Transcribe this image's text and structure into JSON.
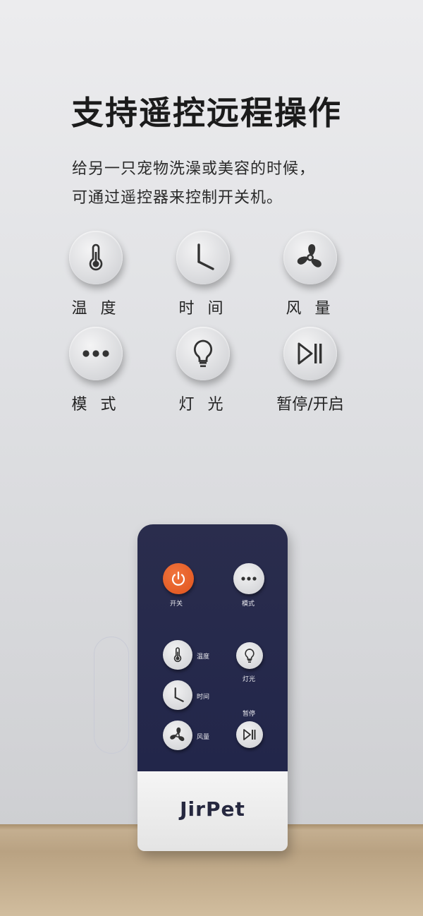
{
  "headline": "支持遥控远程操作",
  "subtitle_line1": "给另一只宠物洗澡或美容的时候，",
  "subtitle_line2": "可通过遥控器来控制开关机。",
  "features": [
    {
      "label": "温 度",
      "icon": "thermometer-icon"
    },
    {
      "label": "时 间",
      "icon": "clock-icon"
    },
    {
      "label": "风 量",
      "icon": "fan-icon"
    },
    {
      "label": "模 式",
      "icon": "dots-icon"
    },
    {
      "label": "灯 光",
      "icon": "bulb-icon"
    },
    {
      "label": "暂停/开启",
      "icon": "play-pause-icon"
    }
  ],
  "remote": {
    "power_label": "开关",
    "mode_label": "模式",
    "temp_label": "温度",
    "time_label": "时间",
    "fan_label": "风量",
    "light_label": "灯光",
    "pause_label": "暂停",
    "brand": "JirPet",
    "power_color": "#e35a23",
    "body_color": "#22264a"
  }
}
